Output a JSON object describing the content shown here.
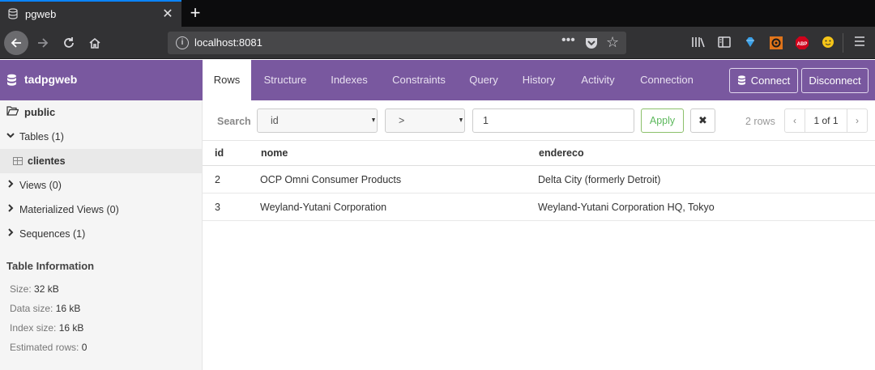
{
  "browser": {
    "tab_title": "pgweb",
    "url": "localhost:8081"
  },
  "app": {
    "brand": "tadpgweb",
    "nav_tabs": [
      {
        "label": "Rows",
        "active": true
      },
      {
        "label": "Structure"
      },
      {
        "label": "Indexes"
      },
      {
        "label": "Constraints"
      },
      {
        "label": "Query"
      },
      {
        "label": "History"
      },
      {
        "label": "Activity"
      },
      {
        "label": "Connection"
      }
    ],
    "connect_label": "Connect",
    "disconnect_label": "Disconnect"
  },
  "sidebar": {
    "schema": "public",
    "tables_label": "Tables (1)",
    "table_item": "clientes",
    "views_label": "Views (0)",
    "matviews_label": "Materialized Views (0)",
    "sequences_label": "Sequences (1)",
    "info_title": "Table Information",
    "info": [
      {
        "label": "Size:",
        "value": "32 kB"
      },
      {
        "label": "Data size:",
        "value": "16 kB"
      },
      {
        "label": "Index size:",
        "value": "16 kB"
      },
      {
        "label": "Estimated rows:",
        "value": "0"
      }
    ]
  },
  "search": {
    "label": "Search",
    "column": "id",
    "operator": ">",
    "value": "1",
    "apply_label": "Apply",
    "reset_label": "✖",
    "rows_count": "2 rows",
    "page": "1 of 1"
  },
  "table": {
    "columns": [
      "id",
      "nome",
      "endereco"
    ],
    "rows": [
      [
        "2",
        "OCP Omni Consumer Products",
        "Delta City (formerly Detroit)"
      ],
      [
        "3",
        "Weyland-Yutani Corporation",
        "Weyland-Yutani Corporation HQ, Tokyo"
      ]
    ]
  },
  "colors": {
    "brand": "#79589f",
    "firefox_accent": "#0a84ff"
  }
}
